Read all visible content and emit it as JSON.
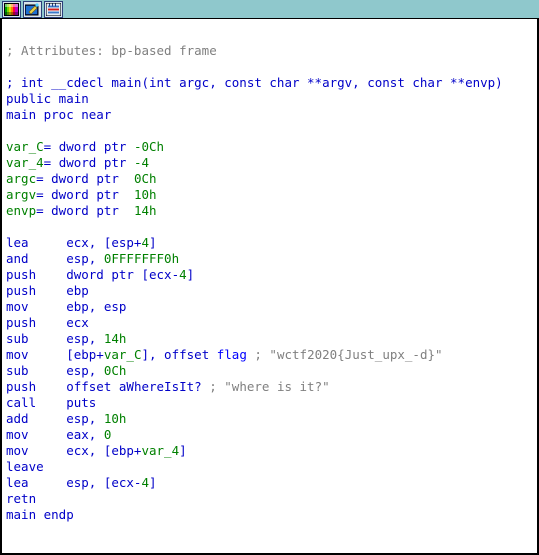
{
  "window": {
    "title": "IDA Pro disassembly view",
    "background_color": "#ffffff",
    "border_color": "#000000"
  },
  "toolbar": {
    "background_color": "#8fc8cc",
    "buttons": [
      {
        "name": "color-palette-icon",
        "label": "Colors"
      },
      {
        "name": "graph-overview-icon",
        "label": "Graph overview"
      },
      {
        "name": "navigator-band-icon",
        "label": "Navigator band"
      }
    ]
  },
  "colors": {
    "comment": "#808080",
    "keyword": "#0000c8",
    "symbol": "#0000ff",
    "number": "#008000",
    "variable": "#008000"
  },
  "disassembly": {
    "function_name": "main",
    "flag_string": "wctf2020{Just_upx_-d}",
    "prompt_string": "where is it?",
    "lines": [
      {
        "text": "",
        "type": "blank"
      },
      {
        "text": "; Attributes: bp-based frame",
        "type": "comment"
      },
      {
        "text": "",
        "type": "blank"
      },
      {
        "text": "; int __cdecl main(int argc, const char **argv, const char **envp)",
        "type": "prototype"
      },
      {
        "text": "public main",
        "type": "directive"
      },
      {
        "text": "main proc near",
        "type": "directive"
      },
      {
        "text": "",
        "type": "blank"
      },
      {
        "text": "var_C= dword ptr -0Ch",
        "type": "vardecl"
      },
      {
        "text": "var_4= dword ptr -4",
        "type": "vardecl"
      },
      {
        "text": "argc= dword ptr  0Ch",
        "type": "vardecl"
      },
      {
        "text": "argv= dword ptr  10h",
        "type": "vardecl"
      },
      {
        "text": "envp= dword ptr  14h",
        "type": "vardecl"
      },
      {
        "text": "",
        "type": "blank"
      },
      {
        "text": "lea     ecx, [esp+4]",
        "type": "instruction"
      },
      {
        "text": "and     esp, 0FFFFFFF0h",
        "type": "instruction"
      },
      {
        "text": "push    dword ptr [ecx-4]",
        "type": "instruction"
      },
      {
        "text": "push    ebp",
        "type": "instruction"
      },
      {
        "text": "mov     ebp, esp",
        "type": "instruction"
      },
      {
        "text": "push    ecx",
        "type": "instruction"
      },
      {
        "text": "sub     esp, 14h",
        "type": "instruction"
      },
      {
        "text": "mov     [ebp+var_C], offset flag ; \"wctf2020{Just_upx_-d}\"",
        "type": "instruction"
      },
      {
        "text": "sub     esp, 0Ch",
        "type": "instruction"
      },
      {
        "text": "push    offset aWhereIsIt? ; \"where is it?\"",
        "type": "instruction"
      },
      {
        "text": "call    puts",
        "type": "instruction"
      },
      {
        "text": "add     esp, 10h",
        "type": "instruction"
      },
      {
        "text": "mov     eax, 0",
        "type": "instruction"
      },
      {
        "text": "mov     ecx, [ebp+var_4]",
        "type": "instruction"
      },
      {
        "text": "leave",
        "type": "instruction"
      },
      {
        "text": "lea     esp, [ecx-4]",
        "type": "instruction"
      },
      {
        "text": "retn",
        "type": "instruction"
      },
      {
        "text": "main endp",
        "type": "directive"
      }
    ],
    "rich_lines": [
      [],
      [
        {
          "t": "; Attributes: bp-based frame",
          "c": "c-comment"
        }
      ],
      [],
      [
        {
          "t": "; int __cdecl main(int argc, const char **argv, const char **envp)",
          "c": "c-kw"
        }
      ],
      [
        {
          "t": "public main",
          "c": "c-kw"
        }
      ],
      [
        {
          "t": "main proc near",
          "c": "c-kw"
        }
      ],
      [],
      [
        {
          "t": "var_C",
          "c": "c-var"
        },
        {
          "t": "= dword ptr ",
          "c": "c-kw"
        },
        {
          "t": "-0Ch",
          "c": "c-num"
        }
      ],
      [
        {
          "t": "var_4",
          "c": "c-var"
        },
        {
          "t": "= dword ptr ",
          "c": "c-kw"
        },
        {
          "t": "-4",
          "c": "c-num"
        }
      ],
      [
        {
          "t": "argc",
          "c": "c-var"
        },
        {
          "t": "= dword ptr  ",
          "c": "c-kw"
        },
        {
          "t": "0Ch",
          "c": "c-num"
        }
      ],
      [
        {
          "t": "argv",
          "c": "c-var"
        },
        {
          "t": "= dword ptr  ",
          "c": "c-kw"
        },
        {
          "t": "10h",
          "c": "c-num"
        }
      ],
      [
        {
          "t": "envp",
          "c": "c-var"
        },
        {
          "t": "= dword ptr  ",
          "c": "c-kw"
        },
        {
          "t": "14h",
          "c": "c-num"
        }
      ],
      [],
      [
        {
          "t": "lea     ecx, [esp+",
          "c": "c-kw"
        },
        {
          "t": "4",
          "c": "c-num"
        },
        {
          "t": "]",
          "c": "c-kw"
        }
      ],
      [
        {
          "t": "and     esp, ",
          "c": "c-kw"
        },
        {
          "t": "0FFFFFFF0h",
          "c": "c-num"
        }
      ],
      [
        {
          "t": "push    dword ptr [ecx-",
          "c": "c-kw"
        },
        {
          "t": "4",
          "c": "c-num"
        },
        {
          "t": "]",
          "c": "c-kw"
        }
      ],
      [
        {
          "t": "push    ebp",
          "c": "c-kw"
        }
      ],
      [
        {
          "t": "mov     ebp, esp",
          "c": "c-kw"
        }
      ],
      [
        {
          "t": "push    ecx",
          "c": "c-kw"
        }
      ],
      [
        {
          "t": "sub     esp, ",
          "c": "c-kw"
        },
        {
          "t": "14h",
          "c": "c-num"
        }
      ],
      [
        {
          "t": "mov     [ebp+",
          "c": "c-kw"
        },
        {
          "t": "var_C",
          "c": "c-var"
        },
        {
          "t": "], offset ",
          "c": "c-kw"
        },
        {
          "t": "flag",
          "c": "c-sym"
        },
        {
          "t": " ; \"wctf2020{Just_upx_-d}\"",
          "c": "c-comment"
        }
      ],
      [
        {
          "t": "sub     esp, ",
          "c": "c-kw"
        },
        {
          "t": "0Ch",
          "c": "c-num"
        }
      ],
      [
        {
          "t": "push    offset ",
          "c": "c-kw"
        },
        {
          "t": "aWhereIsIt?",
          "c": "c-kw"
        },
        {
          "t": " ; \"where is it?\"",
          "c": "c-comment"
        }
      ],
      [
        {
          "t": "call    puts",
          "c": "c-kw"
        }
      ],
      [
        {
          "t": "add     esp, ",
          "c": "c-kw"
        },
        {
          "t": "10h",
          "c": "c-num"
        }
      ],
      [
        {
          "t": "mov     eax, ",
          "c": "c-kw"
        },
        {
          "t": "0",
          "c": "c-num"
        }
      ],
      [
        {
          "t": "mov     ecx, [ebp+",
          "c": "c-kw"
        },
        {
          "t": "var_4",
          "c": "c-var"
        },
        {
          "t": "]",
          "c": "c-kw"
        }
      ],
      [
        {
          "t": "leave",
          "c": "c-kw"
        }
      ],
      [
        {
          "t": "lea     esp, [ecx-",
          "c": "c-kw"
        },
        {
          "t": "4",
          "c": "c-num"
        },
        {
          "t": "]",
          "c": "c-kw"
        }
      ],
      [
        {
          "t": "retn",
          "c": "c-kw"
        }
      ],
      [
        {
          "t": "main endp",
          "c": "c-kw"
        }
      ]
    ]
  }
}
